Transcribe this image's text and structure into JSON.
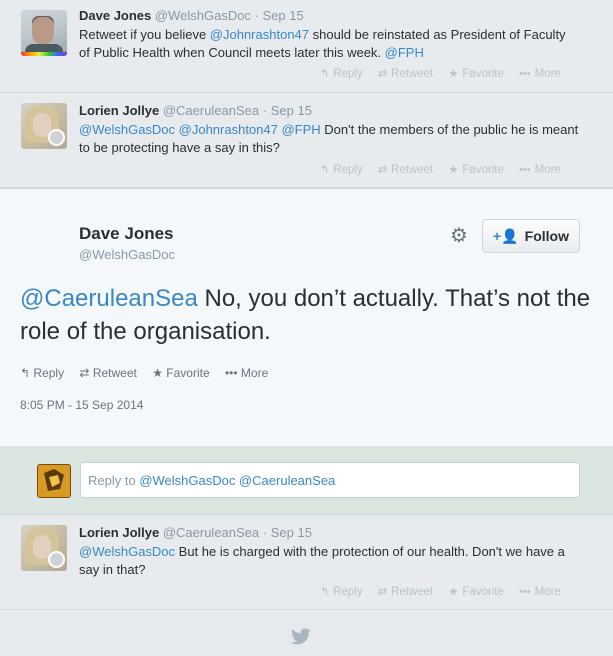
{
  "tweets": [
    {
      "name": "Dave Jones",
      "handle": "@WelshGasDoc",
      "date": "· Sep 15",
      "text_prefix": "Retweet if you believe ",
      "mention1": "@Johnrashton47",
      "text_mid": " should be reinstated as President of Faculty of Public Health when Council meets later this week. ",
      "mention2": "@FPH"
    },
    {
      "name": "Lorien Jollye",
      "handle": "@CaeruleanSea",
      "date": "· Sep 15",
      "mentions": "@WelshGasDoc @Johnrashton47 @FPH",
      "text": " Don't the members of the public he is meant to be protecting have a say in this?"
    },
    {
      "name": "Lorien Jollye",
      "handle": "@CaeruleanSea",
      "date": "· Sep 15",
      "mentions": "@WelshGasDoc",
      "text": " But he is charged with the protection of our health. Don't we have a say in that?"
    }
  ],
  "actions": {
    "reply": "Reply",
    "retweet": "Retweet",
    "favorite": "Favorite",
    "more": "More"
  },
  "main_tweet": {
    "name": "Dave Jones",
    "handle": "@WelshGasDoc",
    "mention": "@CaeruleanSea",
    "text": " No, you don’t actually. That’s not the role of the organisation.",
    "timestamp": "8:05 PM - 15 Sep 2014",
    "follow_label": "Follow"
  },
  "reply_box": {
    "prefix": "Reply to ",
    "mentions": "@WelshGasDoc @CaeruleanSea"
  },
  "colors": {
    "link": "#3a87c6",
    "background": "#e7eaec"
  },
  "icons": [
    "reply-icon",
    "retweet-icon",
    "favorite-icon",
    "more-icon",
    "gear-icon",
    "follow-icon",
    "twitter-bird-icon"
  ]
}
